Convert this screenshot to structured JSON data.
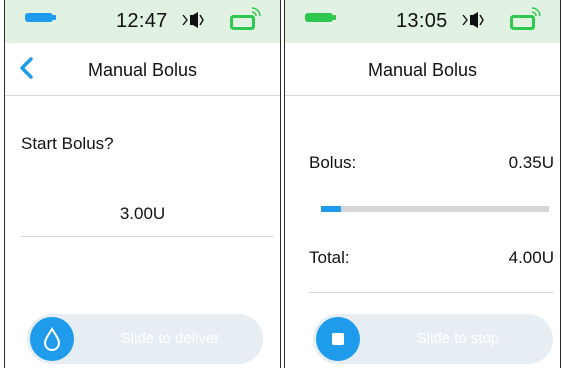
{
  "colors": {
    "accent": "#1e9bea",
    "status_bg": "#e1f1e2",
    "battery_left": "#1e9bea",
    "battery_right": "#2fc84e",
    "signal": "#2fc84e",
    "slider_bg": "#e6eef3",
    "divider": "#d7d7d7"
  },
  "left": {
    "status": {
      "time": "12:47",
      "battery_icon": "battery-icon",
      "vibrate_icon": "vibrate-icon",
      "signal_icon": "signal-icon"
    },
    "header": {
      "title": "Manual Bolus",
      "back_icon": "chevron-left-icon"
    },
    "prompt": "Start Bolus?",
    "amount": "3.00U",
    "slider": {
      "label": "Slide to deliver",
      "knob_icon": "drop-icon"
    }
  },
  "right": {
    "status": {
      "time": "13:05",
      "battery_icon": "battery-icon",
      "vibrate_icon": "vibrate-icon",
      "signal_icon": "signal-icon"
    },
    "header": {
      "title": "Manual Bolus"
    },
    "bolus_label": "Bolus:",
    "bolus_value": "0.35U",
    "progress_fraction": 0.0875,
    "total_label": "Total:",
    "total_value": "4.00U",
    "slider": {
      "label": "Slide to stop",
      "knob_icon": "stop-icon"
    }
  }
}
